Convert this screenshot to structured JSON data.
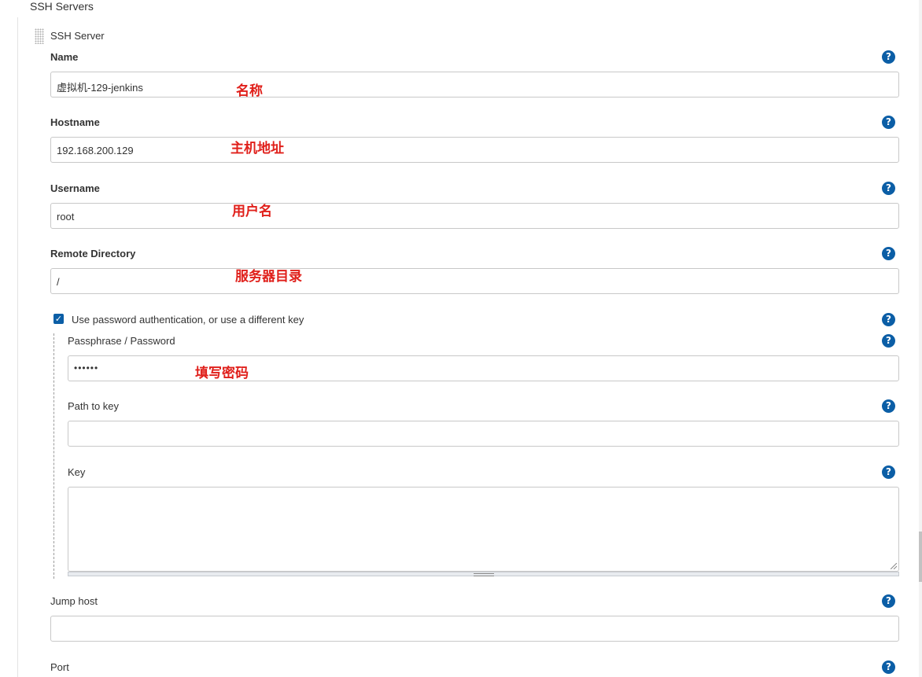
{
  "section": {
    "title": "SSH Servers"
  },
  "server": {
    "title": "SSH Server",
    "name": {
      "label": "Name",
      "value": "虚拟机-129-jenkins",
      "annotation": "名称"
    },
    "hostname": {
      "label": "Hostname",
      "value": "192.168.200.129",
      "annotation": "主机地址"
    },
    "username": {
      "label": "Username",
      "value": "root",
      "annotation": "用户名"
    },
    "remote_directory": {
      "label": "Remote Directory",
      "value": "/",
      "annotation": "服务器目录"
    },
    "use_password": {
      "label": "Use password authentication, or use a different key",
      "checked": true
    },
    "passphrase": {
      "label": "Passphrase / Password",
      "value": "••••••",
      "annotation": "填写密码"
    },
    "path_to_key": {
      "label": "Path to key",
      "value": ""
    },
    "key": {
      "label": "Key",
      "value": ""
    },
    "jump_host": {
      "label": "Jump host",
      "value": ""
    },
    "port": {
      "label": "Port"
    }
  },
  "help_symbol": "?",
  "check_symbol": "✓",
  "icons": {
    "help": "help-icon",
    "drag": "drag-handle-icon",
    "check": "checkmark-icon"
  },
  "colors": {
    "accent": "#0b5ea6",
    "annotation": "#e0201b",
    "border": "#c8c8c8"
  }
}
